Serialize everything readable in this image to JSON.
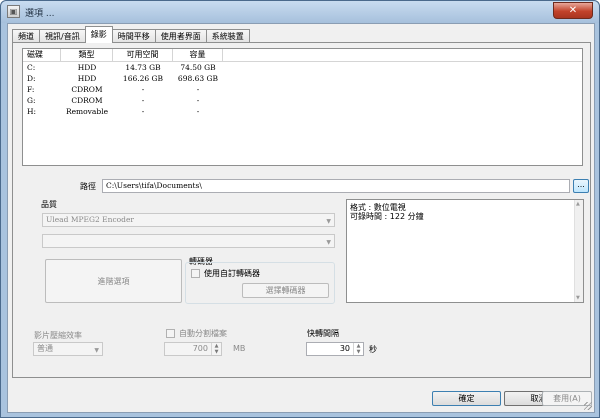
{
  "window": {
    "title": "選項 ...",
    "close_label": "✕"
  },
  "tabs": [
    {
      "label": "頻道"
    },
    {
      "label": "視訊/音訊"
    },
    {
      "label": "錄影"
    },
    {
      "label": "時間平移"
    },
    {
      "label": "使用者界面"
    },
    {
      "label": "系統裝置"
    }
  ],
  "active_tab": "錄影",
  "drive_table": {
    "columns": [
      "磁碟",
      "類型",
      "可用空間",
      "容量"
    ],
    "rows": [
      {
        "drive": "C:",
        "type": "HDD",
        "free": "14.73 GB",
        "capacity": "74.50 GB"
      },
      {
        "drive": "D:",
        "type": "HDD",
        "free": "166.26 GB",
        "capacity": "698.63 GB"
      },
      {
        "drive": "F:",
        "type": "CDROM",
        "free": "-",
        "capacity": "-"
      },
      {
        "drive": "G:",
        "type": "CDROM",
        "free": "-",
        "capacity": "-"
      },
      {
        "drive": "H:",
        "type": "Removable",
        "free": "-",
        "capacity": "-"
      }
    ]
  },
  "path": {
    "label": "路徑",
    "value": "C:\\Users\\tifa\\Documents\\",
    "browse_label": "..."
  },
  "quality": {
    "group_label": "品質",
    "encoder_value": "Ulead MPEG2 Encoder",
    "second_value": "",
    "advanced_button": "進階選項",
    "transcoder_group": "轉碼器",
    "custom_transcoder_checkbox": "使用自訂轉碼器",
    "custom_transcoder_checked": false,
    "select_transcoder_button": "選擇轉碼器"
  },
  "info": {
    "format_line": "格式 : 數位電視",
    "time_line": "可錄時間 : 122 分鐘"
  },
  "compression": {
    "label": "影片壓縮效率",
    "value": "普通"
  },
  "auto_split": {
    "label": "自動分割檔案",
    "checked": false,
    "value": "700",
    "unit": "MB"
  },
  "skip_interval": {
    "label": "快轉間隔",
    "value": "30",
    "unit": "秒"
  },
  "buttons": {
    "ok": "確定",
    "cancel": "取消",
    "apply": "套用(A)"
  }
}
